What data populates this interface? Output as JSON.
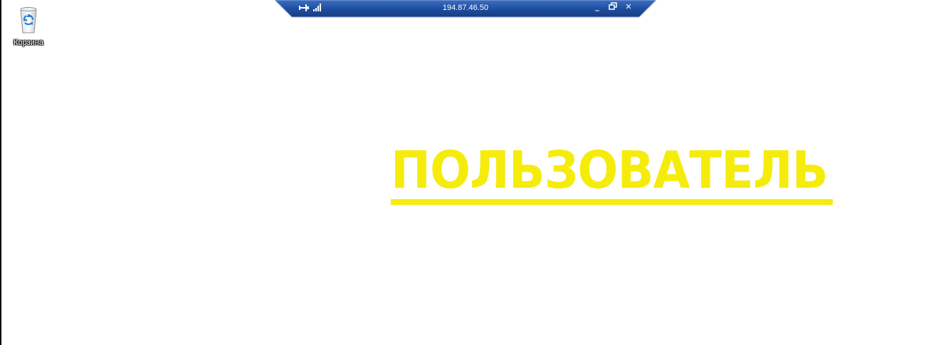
{
  "desktop": {
    "icons": [
      {
        "label": "Корзина",
        "icon": "recycle-bin-icon"
      }
    ],
    "banner": {
      "text": "ПОЛЬЗОВАТЕЛЬ",
      "color": "#f5ec0c"
    }
  },
  "rdp_bar": {
    "title": "194.87.46.50",
    "pin_icon": "pin-icon",
    "signal_icon": "signal-strength-icon",
    "controls": {
      "minimize": "minimize-icon",
      "restore": "restore-icon",
      "close": "close-icon"
    },
    "bg_color": "#1f4fa0"
  }
}
